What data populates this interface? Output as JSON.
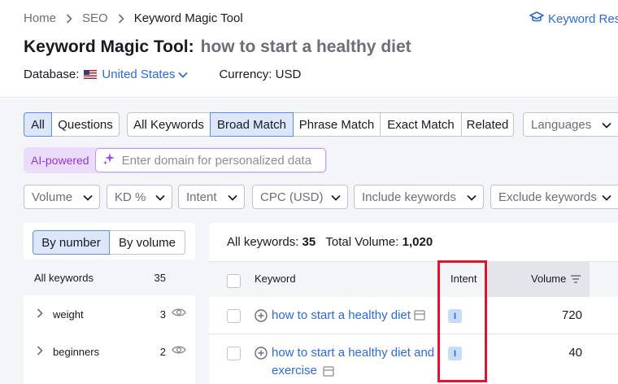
{
  "breadcrumb": {
    "home": "Home",
    "seo": "SEO",
    "current": "Keyword Magic Tool"
  },
  "header_link": "Keyword Rese",
  "title": {
    "tool": "Keyword Magic Tool:",
    "query": "how to start a healthy diet"
  },
  "database": {
    "label": "Database:",
    "value": "United States",
    "currency": "Currency: USD"
  },
  "filters1": {
    "type_tabs": [
      "All",
      "Questions"
    ],
    "match_tabs": [
      "All Keywords",
      "Broad Match",
      "Phrase Match",
      "Exact Match",
      "Related"
    ],
    "languages": "Languages"
  },
  "ai": {
    "label": "AI-powered",
    "placeholder": "Enter domain for personalized data"
  },
  "filters2": [
    "Volume",
    "KD %",
    "Intent",
    "CPC (USD)",
    "Include keywords",
    "Exclude keywords"
  ],
  "left_panel": {
    "tabs": [
      "By number",
      "By volume"
    ],
    "rows": [
      {
        "name": "All keywords",
        "count": "35"
      },
      {
        "name": "weight",
        "count": "3"
      },
      {
        "name": "beginners",
        "count": "2"
      }
    ]
  },
  "summary": {
    "all_label": "All keywords:",
    "all_count": "35",
    "vol_label": "Total Volume:",
    "vol_value": "1,020"
  },
  "table": {
    "headers": {
      "keyword": "Keyword",
      "intent": "Intent",
      "volume": "Volume"
    },
    "rows": [
      {
        "keyword": "how to start a healthy diet",
        "intent": "I",
        "volume": "720"
      },
      {
        "keyword_line1": "how to start a healthy diet and",
        "keyword_line2": "exercise",
        "intent": "I",
        "volume": "40"
      }
    ]
  },
  "colors": {
    "accent": "#2d6ad8",
    "selected_bg": "#dce7fb",
    "ai_purple": "#8f37df",
    "highlight_red": "#e3122d"
  }
}
